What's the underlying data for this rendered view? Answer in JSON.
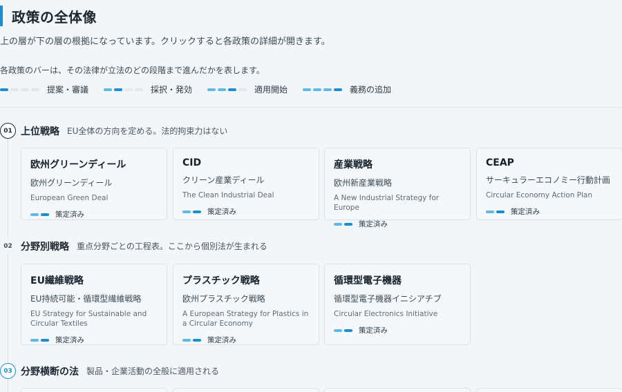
{
  "header": {
    "title": "政策の全体像",
    "intro": "上の層が下の層の根拠になっています。クリックすると各政策の詳細が開きます。",
    "legend_desc": "各政策のバーは、その法律が立法のどの段階まで進んだかを表します。"
  },
  "legend": [
    {
      "label": "提案・審議",
      "level": 1
    },
    {
      "label": "採択・発効",
      "level": 2
    },
    {
      "label": "適用開始",
      "level": 3
    },
    {
      "label": "義務の追加",
      "level": 4
    }
  ],
  "colors": {
    "accent": "#1a8fd0",
    "accent_light": "#5fb8e6",
    "inactive": "#e1e8ed"
  },
  "sections": [
    {
      "num": "01",
      "title": "上位戦略",
      "desc": "EU全体の方向を定める。法的拘束力はない",
      "cards": [
        {
          "name": "欧州グリーンディール",
          "jp": "欧州グリーンディール",
          "en": "European Green Deal",
          "status": "策定済み"
        },
        {
          "name": "CID",
          "jp": "クリーン産業ディール",
          "en": "The Clean Industrial Deal",
          "status": "策定済み"
        },
        {
          "name": "産業戦略",
          "jp": "欧州新産業戦略",
          "en": "A New Industrial Strategy for Europe",
          "status": "策定済み"
        },
        {
          "name": "CEAP",
          "jp": "サーキュラーエコノミー行動計画",
          "en": "Circular Economy Action Plan",
          "status": "策定済み"
        }
      ]
    },
    {
      "num": "02",
      "title": "分野別戦略",
      "desc": "重点分野ごとの工程表。ここから個別法が生まれる",
      "cards": [
        {
          "name": "EU繊維戦略",
          "jp": "EU持続可能・循環型繊維戦略",
          "en": "EU Strategy for Sustainable and Circular Textiles",
          "status": "策定済み"
        },
        {
          "name": "プラスチック戦略",
          "jp": "欧州プラスチック戦略",
          "en": "A European Strategy for Plastics in a Circular Economy",
          "status": "策定済み"
        },
        {
          "name": "循環型電子機器",
          "jp": "循環型電子機器イニシアチブ",
          "en": "Circular Electronics Initiative",
          "status": "策定済み"
        }
      ]
    },
    {
      "num": "03",
      "title": "分野横断の法",
      "desc": "製品・企業活動の全般に適用される",
      "cards": []
    }
  ]
}
